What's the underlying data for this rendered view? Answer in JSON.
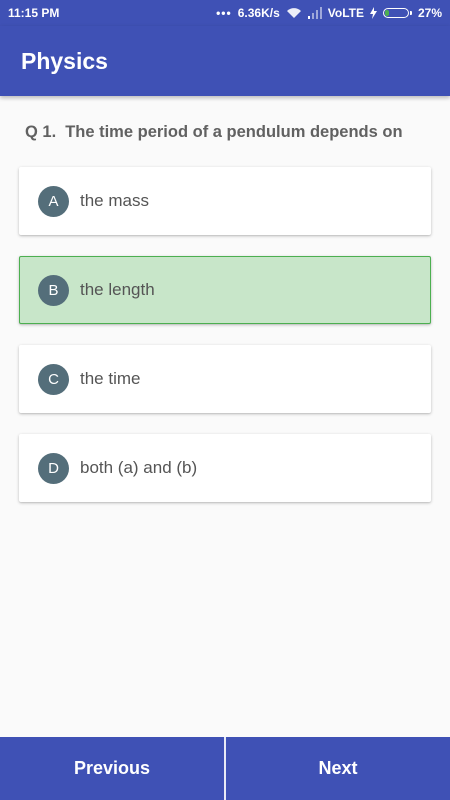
{
  "status_bar": {
    "time": "11:15 PM",
    "dots": "•••",
    "network_speed": "6.36K/s",
    "network_type": "VoLTE",
    "battery_percent": "27%",
    "battery_level": 0.27,
    "battery_fill_color": "#4caf50"
  },
  "app_bar": {
    "title": "Physics",
    "color": "#3f51b5"
  },
  "question": {
    "number": "Q 1.",
    "text": "The time period of a pendulum depends on"
  },
  "options": [
    {
      "letter": "A",
      "text": "the mass",
      "selected": false
    },
    {
      "letter": "B",
      "text": "the length",
      "selected": true
    },
    {
      "letter": "C",
      "text": "the time",
      "selected": false
    },
    {
      "letter": "D",
      "text": "both (a) and (b)",
      "selected": false
    }
  ],
  "navigation": {
    "previous_label": "Previous",
    "next_label": "Next"
  }
}
